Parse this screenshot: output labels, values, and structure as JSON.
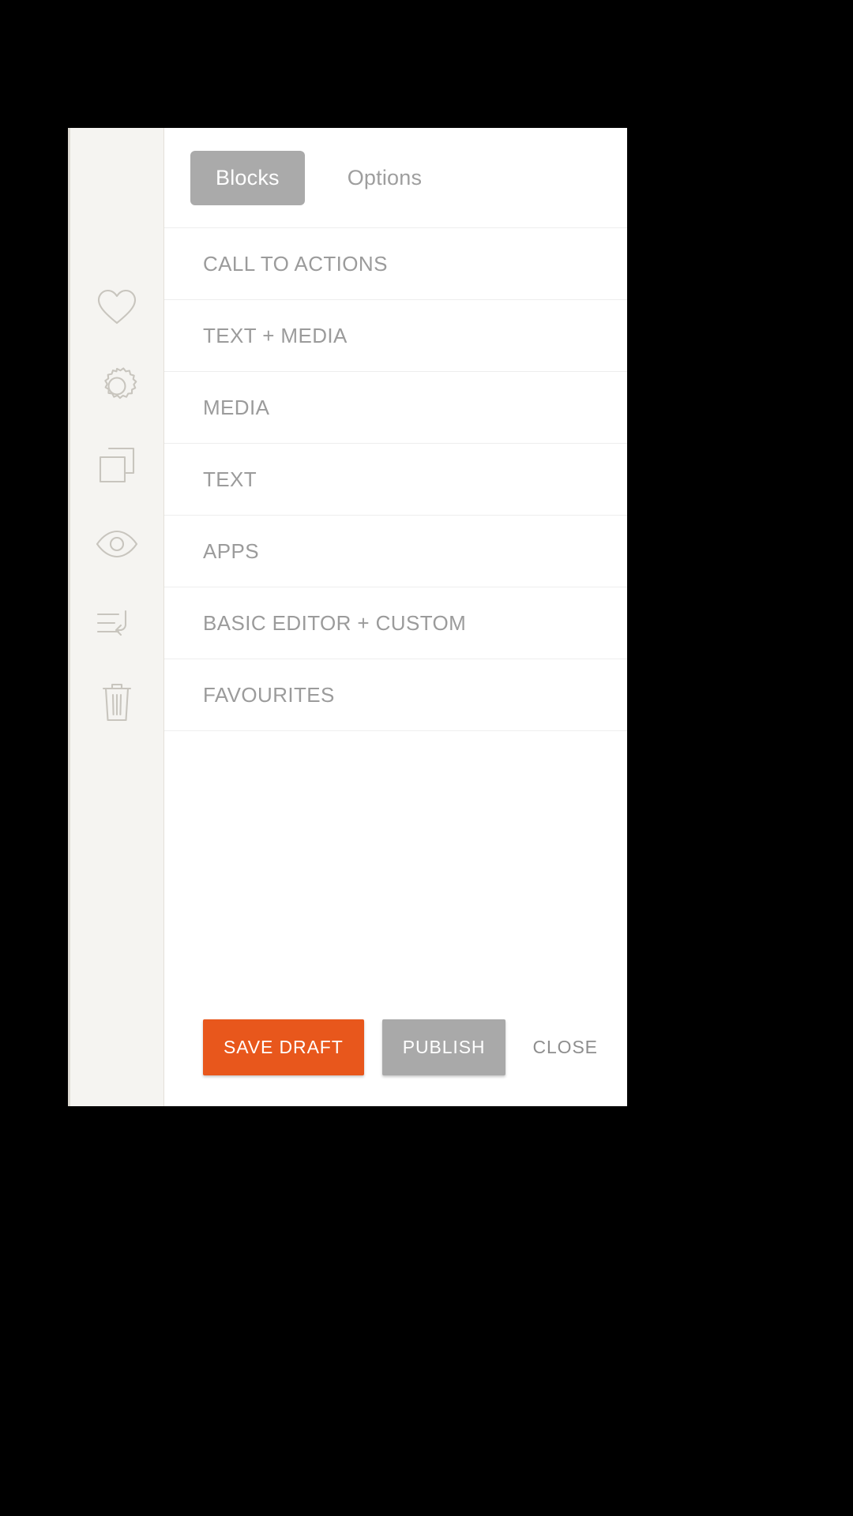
{
  "theme": {
    "page_background": "#000000",
    "panel_background": "#ffffff",
    "rail_background": "#f5f4f1",
    "icon_stroke": "#c8c5be",
    "divider": "#eeeeee",
    "muted_text": "#9b9b9b",
    "accent_orange": "#e8571c",
    "accent_grey": "#a9a9a9",
    "active_tab_background": "#aaaaaa"
  },
  "sidebar": {
    "items": [
      {
        "name": "heart-icon",
        "label": "Favourites"
      },
      {
        "name": "gear-icon",
        "label": "Settings"
      },
      {
        "name": "duplicate-icon",
        "label": "Duplicate"
      },
      {
        "name": "eye-icon",
        "label": "Preview"
      },
      {
        "name": "revert-icon",
        "label": "Revert"
      },
      {
        "name": "trash-icon",
        "label": "Delete"
      }
    ]
  },
  "tabs": [
    {
      "label": "Blocks",
      "active": true
    },
    {
      "label": "Options",
      "active": false
    }
  ],
  "block_categories": [
    {
      "label": "CALL TO ACTIONS"
    },
    {
      "label": "TEXT + MEDIA"
    },
    {
      "label": "MEDIA"
    },
    {
      "label": "TEXT"
    },
    {
      "label": "APPS"
    },
    {
      "label": "BASIC EDITOR + CUSTOM"
    },
    {
      "label": "FAVOURITES"
    }
  ],
  "actions": {
    "save_draft_label": "SAVE DRAFT",
    "publish_label": "PUBLISH",
    "close_label": "CLOSE"
  }
}
